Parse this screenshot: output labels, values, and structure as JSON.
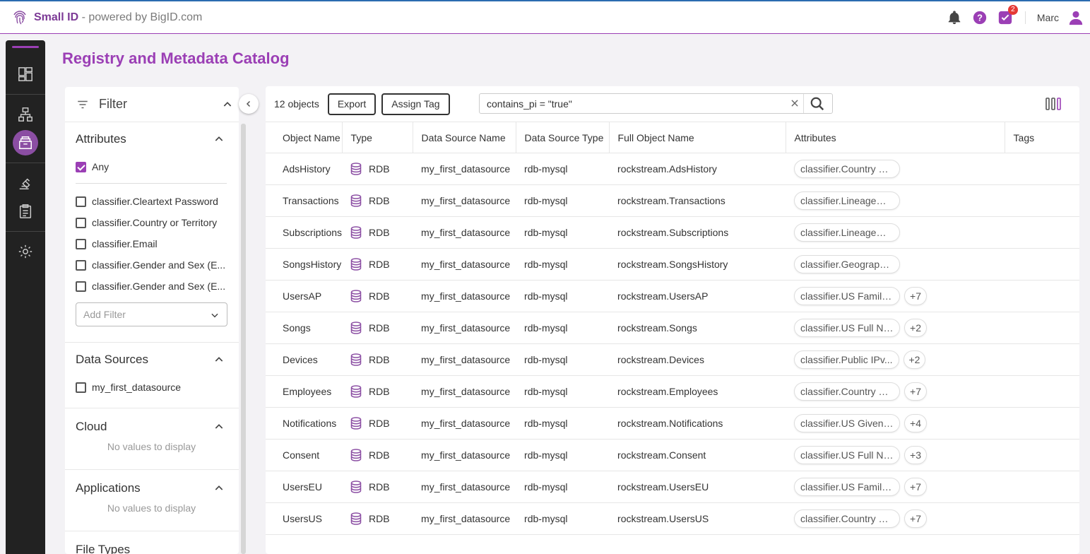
{
  "header": {
    "brand_name": "Small ID",
    "brand_suffix": " - powered by BigID.com",
    "notification_count": "2",
    "user_name": "Marc"
  },
  "page_title": "Registry and Metadata Catalog",
  "filter": {
    "title": "Filter",
    "attributes": {
      "title": "Attributes",
      "any_label": "Any",
      "items": [
        "classifier.Cleartext Password",
        "classifier.Country or Territory",
        "classifier.Email",
        "classifier.Gender and Sex (E...",
        "classifier.Gender and Sex (E..."
      ],
      "add_filter_placeholder": "Add Filter"
    },
    "data_sources": {
      "title": "Data Sources",
      "items": [
        "my_first_datasource"
      ]
    },
    "cloud": {
      "title": "Cloud",
      "empty": "No values to display"
    },
    "applications": {
      "title": "Applications",
      "empty": "No values to display"
    },
    "file_types": {
      "title": "File Types"
    }
  },
  "toolbar": {
    "count": "12 objects",
    "export_label": "Export",
    "assign_tag_label": "Assign Tag",
    "search_value": "contains_pi = \"true\""
  },
  "table": {
    "columns": [
      "Object Name",
      "Type",
      "Data Source Name",
      "Data Source Type",
      "Full Object Name",
      "Attributes",
      "Tags"
    ],
    "rows": [
      {
        "name": "AdsHistory",
        "type": "RDB",
        "ds": "my_first_datasource",
        "dstype": "rdb-mysql",
        "full": "rockstream.AdsHistory",
        "attr": "classifier.Country or ...",
        "more": ""
      },
      {
        "name": "Transactions",
        "type": "RDB",
        "ds": "my_first_datasource",
        "dstype": "rdb-mysql",
        "full": "rockstream.Transactions",
        "attr": "classifier.LineageGuid",
        "more": ""
      },
      {
        "name": "Subscriptions",
        "type": "RDB",
        "ds": "my_first_datasource",
        "dstype": "rdb-mysql",
        "full": "rockstream.Subscriptions",
        "attr": "classifier.LineageGuid",
        "more": ""
      },
      {
        "name": "SongsHistory",
        "type": "RDB",
        "ds": "my_first_datasource",
        "dstype": "rdb-mysql",
        "full": "rockstream.SongsHistory",
        "attr": "classifier.Geographic...",
        "more": ""
      },
      {
        "name": "UsersAP",
        "type": "RDB",
        "ds": "my_first_datasource",
        "dstype": "rdb-mysql",
        "full": "rockstream.UsersAP",
        "attr": "classifier.US Family ...",
        "more": "+7"
      },
      {
        "name": "Songs",
        "type": "RDB",
        "ds": "my_first_datasource",
        "dstype": "rdb-mysql",
        "full": "rockstream.Songs",
        "attr": "classifier.US Full Na...",
        "more": "+2"
      },
      {
        "name": "Devices",
        "type": "RDB",
        "ds": "my_first_datasource",
        "dstype": "rdb-mysql",
        "full": "rockstream.Devices",
        "attr": "classifier.Public IPv...",
        "more": "+2"
      },
      {
        "name": "Employees",
        "type": "RDB",
        "ds": "my_first_datasource",
        "dstype": "rdb-mysql",
        "full": "rockstream.Employees",
        "attr": "classifier.Country or...",
        "more": "+7"
      },
      {
        "name": "Notifications",
        "type": "RDB",
        "ds": "my_first_datasource",
        "dstype": "rdb-mysql",
        "full": "rockstream.Notifications",
        "attr": "classifier.US Given ...",
        "more": "+4"
      },
      {
        "name": "Consent",
        "type": "RDB",
        "ds": "my_first_datasource",
        "dstype": "rdb-mysql",
        "full": "rockstream.Consent",
        "attr": "classifier.US Full Na...",
        "more": "+3"
      },
      {
        "name": "UsersEU",
        "type": "RDB",
        "ds": "my_first_datasource",
        "dstype": "rdb-mysql",
        "full": "rockstream.UsersEU",
        "attr": "classifier.US Family ...",
        "more": "+7"
      },
      {
        "name": "UsersUS",
        "type": "RDB",
        "ds": "my_first_datasource",
        "dstype": "rdb-mysql",
        "full": "rockstream.UsersUS",
        "attr": "classifier.Country or...",
        "more": "+7"
      }
    ]
  },
  "colors": {
    "accent": "#9b3fb5",
    "nav_bg": "#222222"
  },
  "icons": [
    "fingerprint-logo-icon",
    "bell-icon",
    "help-icon",
    "tasks-icon",
    "user-icon",
    "dashboard-icon",
    "sitemap-icon",
    "catalog-icon",
    "policy-icon",
    "clipboard-icon",
    "gear-icon",
    "filter-icon",
    "chevron-up-icon",
    "chevron-down-icon",
    "chevron-left-icon",
    "close-icon",
    "search-icon",
    "columns-icon",
    "database-icon"
  ]
}
